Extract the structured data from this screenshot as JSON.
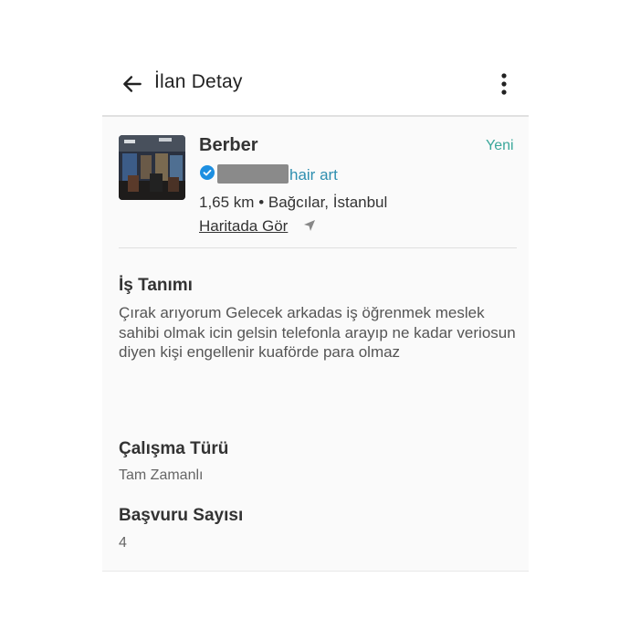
{
  "header": {
    "title": "İlan Detay"
  },
  "job": {
    "title": "Berber",
    "badge": "Yeni",
    "company": "hair art",
    "location": "1,65 km • Bağcılar, İstanbul",
    "map_link": "Haritada Gör"
  },
  "description": {
    "heading": "İş Tanımı",
    "text": "Çırak arıyorum Gelecek arkadas iş öğrenmek meslek sahibi olmak icin gelsin telefonla arayıp ne kadar veriosun diyen kişi engellenir kuaförde para olmaz"
  },
  "work_type": {
    "heading": "Çalışma Türü",
    "value": "Tam Zamanlı"
  },
  "applications": {
    "heading": "Başvuru Sayısı",
    "value": "4"
  },
  "colors": {
    "accent_green": "#3aa79a",
    "link_blue": "#2f8fb0",
    "verified_blue": "#1d8fe1"
  },
  "icons": {
    "back": "arrow-left-icon",
    "more": "more-vertical-icon",
    "verified": "verified-badge-icon",
    "navigate": "navigation-arrow-icon"
  }
}
